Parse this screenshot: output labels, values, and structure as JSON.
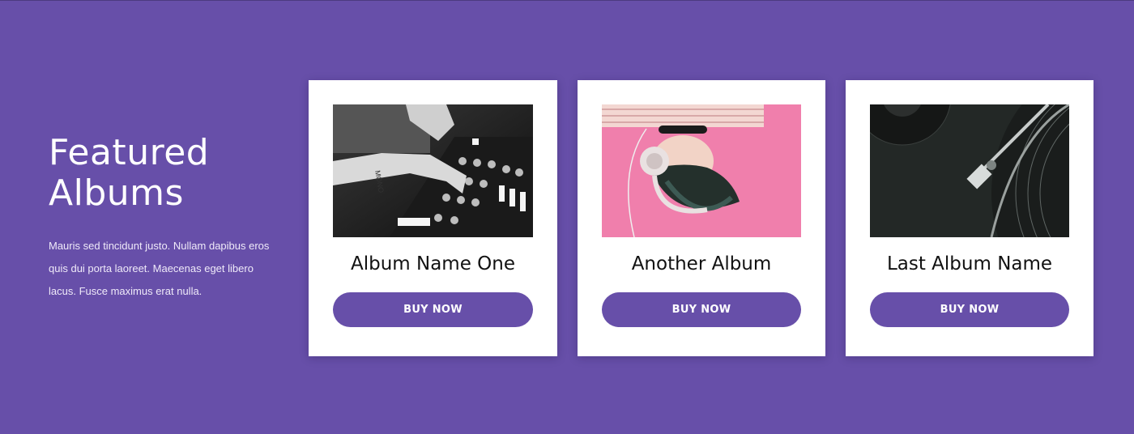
{
  "featured": {
    "heading_line1": "Featured",
    "heading_line2": "Albums",
    "description": "Mauris sed tincidunt justo. Nullam dapibus eros quis dui porta laoreet. Maecenas eget libero lacus. Fusce maximus erat nulla."
  },
  "albums": [
    {
      "title": "Album Name One",
      "button_label": "BUY NOW",
      "image": "dj-mixer-photo"
    },
    {
      "title": "Another Album",
      "button_label": "BUY NOW",
      "image": "headphones-pink-photo"
    },
    {
      "title": "Last Album Name",
      "button_label": "BUY NOW",
      "image": "vinyl-turntable-photo"
    }
  ],
  "colors": {
    "background": "#674fa9",
    "card": "#ffffff",
    "button": "#674fa9",
    "button_text": "#ffffff"
  }
}
